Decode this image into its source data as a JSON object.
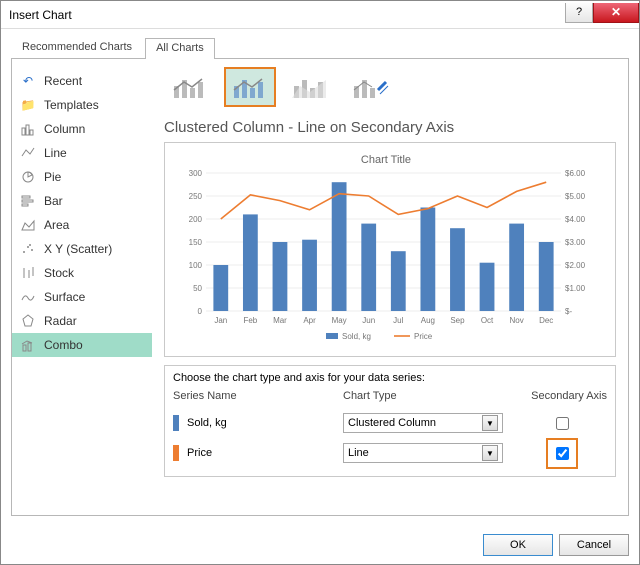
{
  "window": {
    "title": "Insert Chart"
  },
  "tabs": {
    "recommended": "Recommended Charts",
    "all": "All Charts"
  },
  "sidebar": {
    "items": [
      {
        "label": "Recent"
      },
      {
        "label": "Templates"
      },
      {
        "label": "Column"
      },
      {
        "label": "Line"
      },
      {
        "label": "Pie"
      },
      {
        "label": "Bar"
      },
      {
        "label": "Area"
      },
      {
        "label": "X Y (Scatter)"
      },
      {
        "label": "Stock"
      },
      {
        "label": "Surface"
      },
      {
        "label": "Radar"
      },
      {
        "label": "Combo"
      }
    ]
  },
  "preview": {
    "title": "Clustered Column - Line on Secondary Axis",
    "chart_title": "Chart Title",
    "legend": {
      "sold": "Sold, kg",
      "price": "Price"
    }
  },
  "series_config": {
    "prompt": "Choose the chart type and axis for your data series:",
    "headers": {
      "name": "Series Name",
      "type": "Chart Type",
      "axis": "Secondary Axis"
    },
    "rows": [
      {
        "name": "Sold, kg",
        "type": "Clustered Column",
        "secondary": false,
        "color": "#4f81bd"
      },
      {
        "name": "Price",
        "type": "Line",
        "secondary": true,
        "color": "#ed7d31"
      }
    ]
  },
  "buttons": {
    "ok": "OK",
    "cancel": "Cancel"
  },
  "chart_data": {
    "type": "combo",
    "title": "Chart Title",
    "categories": [
      "Jan",
      "Feb",
      "Mar",
      "Apr",
      "May",
      "Jun",
      "Jul",
      "Aug",
      "Sep",
      "Oct",
      "Nov",
      "Dec"
    ],
    "series": [
      {
        "name": "Sold, kg",
        "type": "bar",
        "axis": "primary",
        "values": [
          100,
          210,
          150,
          155,
          280,
          190,
          130,
          225,
          180,
          105,
          190,
          150
        ],
        "color": "#4f81bd"
      },
      {
        "name": "Price",
        "type": "line",
        "axis": "secondary",
        "values": [
          4.0,
          5.05,
          4.8,
          4.4,
          5.1,
          5.0,
          4.2,
          4.45,
          5.0,
          4.5,
          5.2,
          5.6
        ],
        "color": "#ed7d31"
      }
    ],
    "y_primary": {
      "min": 0,
      "max": 300,
      "step": 50,
      "ticks": [
        0,
        50,
        100,
        150,
        200,
        250,
        300
      ]
    },
    "y_secondary": {
      "min": 0,
      "max": 6,
      "step": 1,
      "ticks": [
        "$-",
        "$1.00",
        "$2.00",
        "$3.00",
        "$4.00",
        "$5.00",
        "$6.00"
      ]
    }
  }
}
